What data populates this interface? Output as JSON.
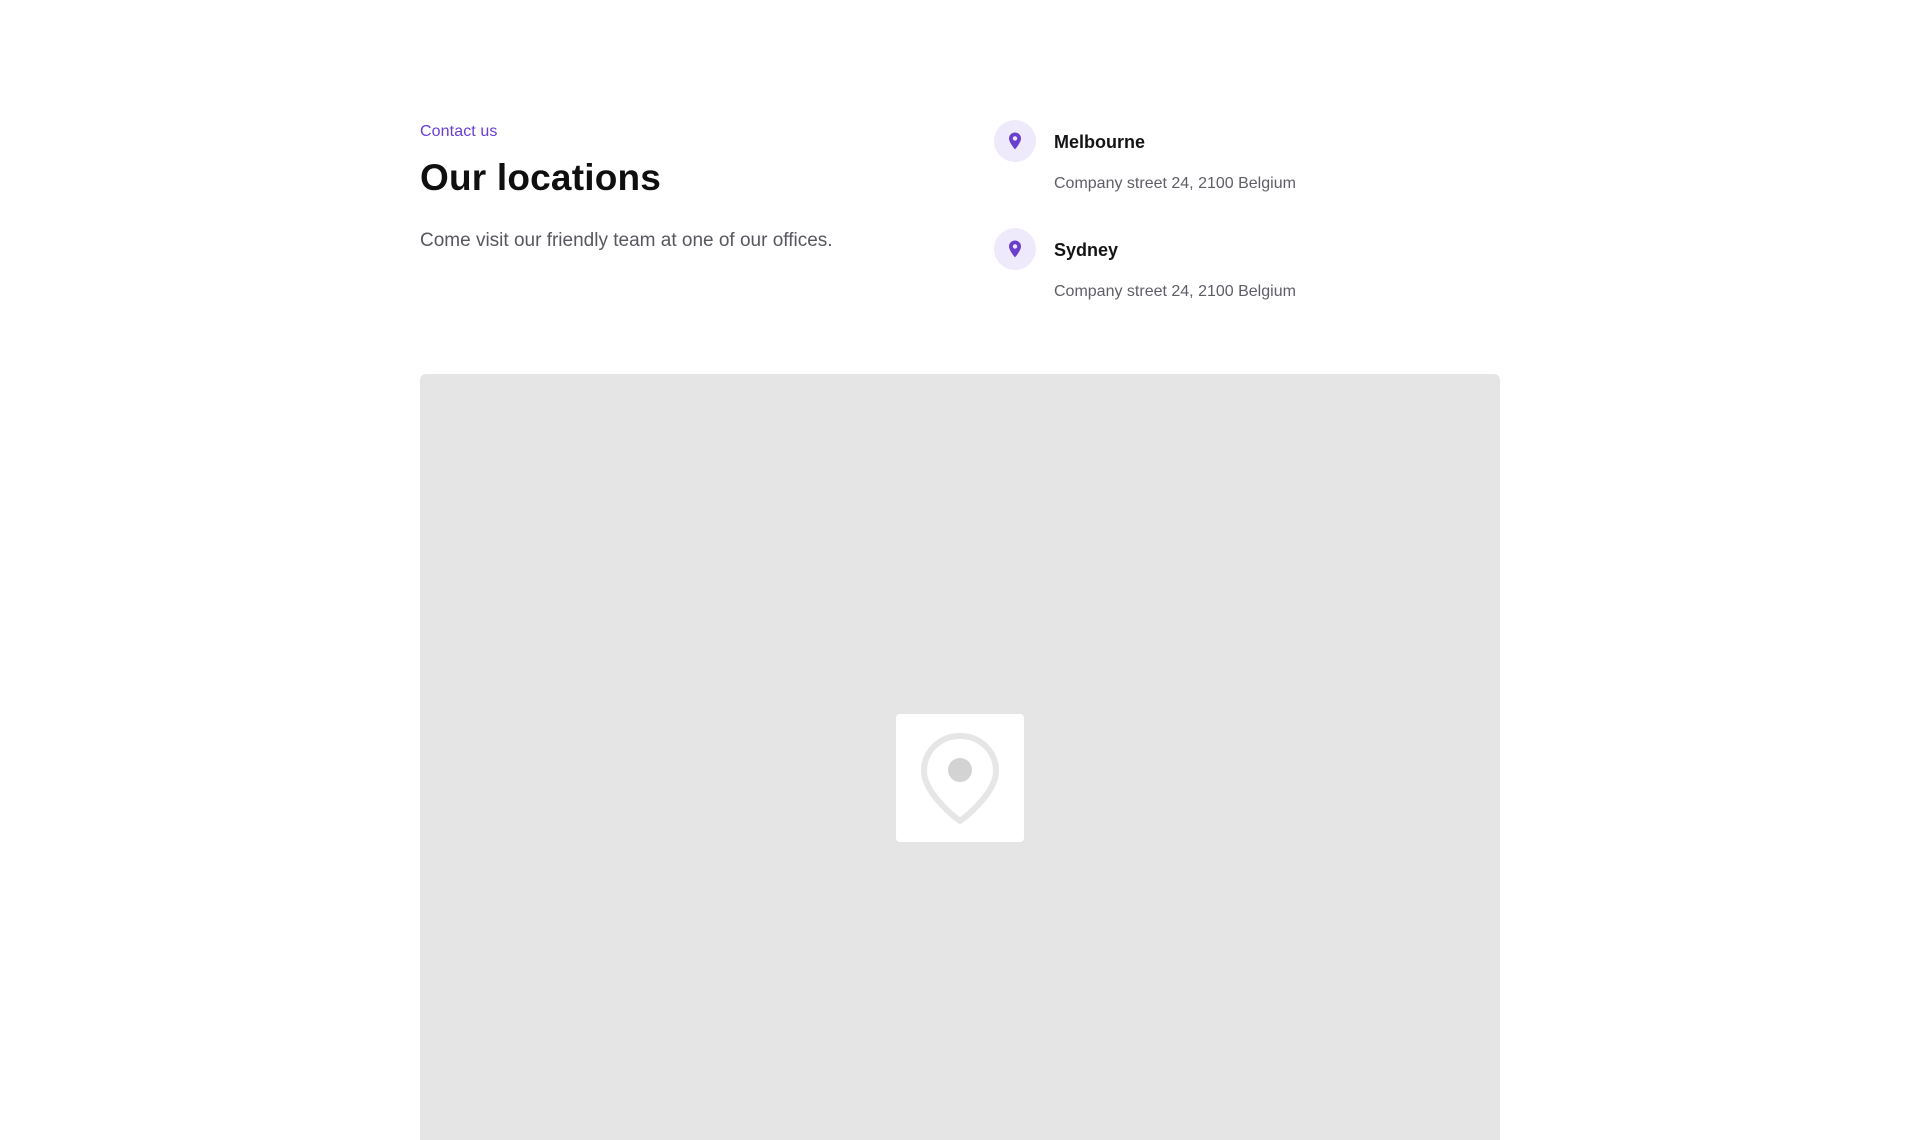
{
  "header": {
    "eyebrow": "Contact us",
    "title": "Our locations",
    "lead": "Come visit our friendly team at one of our offices."
  },
  "locations": [
    {
      "name": "Melbourne",
      "address": "Company street 24, 2100 Belgium",
      "icon": "map-pin-icon"
    },
    {
      "name": "Sydney",
      "address": "Company street 24, 2100 Belgium",
      "icon": "map-pin-icon"
    }
  ],
  "map": {
    "placeholder_icon": "map-placeholder-pin-icon"
  },
  "colors": {
    "accent": "#6a3fd0",
    "icon_bg": "#efe9fc",
    "map_bg": "#e5e5e5"
  }
}
